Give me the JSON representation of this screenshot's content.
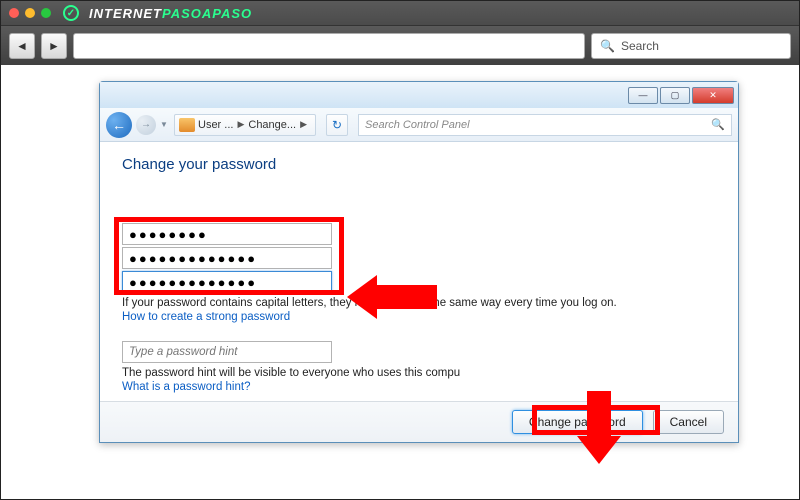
{
  "browser": {
    "logo_plain": "INTERNET",
    "logo_accent": "PASOAPASO",
    "search_placeholder": "Search"
  },
  "window": {
    "breadcrumb_user": "User ...",
    "breadcrumb_page": "Change...",
    "control_panel_search_placeholder": "Search Control Panel"
  },
  "page": {
    "heading": "Change your password",
    "pw_current": "●●●●●●●●",
    "pw_new": "●●●●●●●●●●●●●",
    "pw_confirm": "●●●●●●●●●●●●●",
    "caps_note": "If your password contains capital letters, they must be typed the same way every time you log on.",
    "strong_link": "How to create a strong password",
    "hint_placeholder": "Type a password hint",
    "hint_note": "The password hint will be visible to everyone who uses this compu",
    "hint_link": "What is a password hint?"
  },
  "buttons": {
    "primary": "Change password",
    "cancel": "Cancel"
  }
}
